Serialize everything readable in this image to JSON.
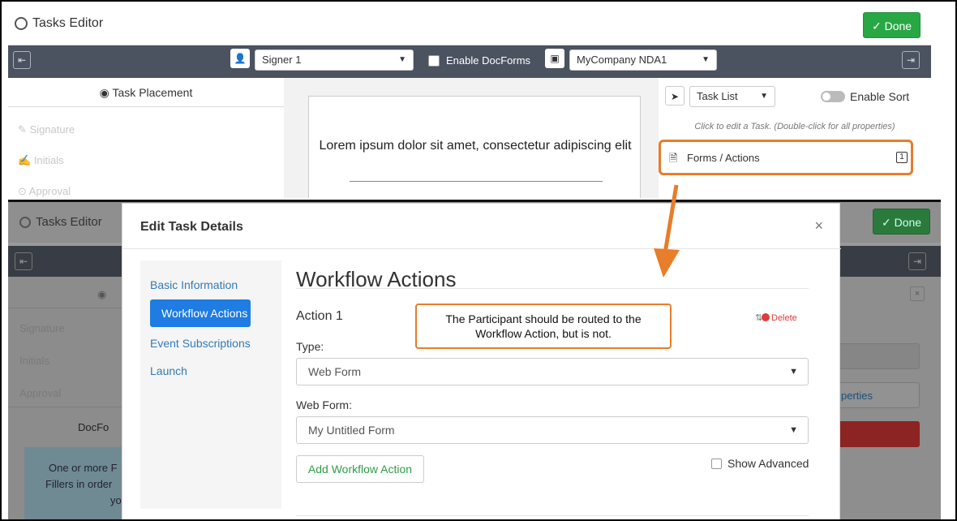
{
  "top": {
    "title": "Tasks Editor",
    "done_label": "✓ Done",
    "toolbar": {
      "signer": "Signer 1",
      "enable_docforms": "Enable DocForms",
      "document": "MyCompany NDA1"
    },
    "left_pane": {
      "header": "Task Placement",
      "items": [
        "Signature",
        "Initials",
        "Approval"
      ]
    },
    "document_text": "Lorem ipsum dolor sit amet, consectetur adipiscing elit",
    "right_pane": {
      "view_select": "Task List",
      "enable_sort": "Enable Sort",
      "hint": "Click to edit a Task. (Double-click for all properties)",
      "item_label": "Forms / Actions",
      "item_badge": "1"
    }
  },
  "bottom": {
    "title": "Tasks Editor",
    "done_label": "✓ Done",
    "left_items": [
      "Signature",
      "Initials",
      "Approval"
    ],
    "docforms_label": "DocFo",
    "info_lines": [
      "One or more F",
      "Fillers in order",
      "yo"
    ],
    "right_label": "perties"
  },
  "modal": {
    "title": "Edit Task Details",
    "close": "×",
    "nav": [
      "Basic Information",
      "Workflow Actions",
      "Event Subscriptions",
      "Launch"
    ],
    "heading": "Workflow Actions",
    "action_title": "Action 1",
    "delete_label": "Delete",
    "type_label": "Type:",
    "type_value": "Web Form",
    "web_form_label": "Web Form:",
    "web_form_value": "My Untitled Form",
    "add_button": "Add Workflow Action",
    "show_advanced": "Show Advanced"
  },
  "callout": {
    "line1": "The Participant should be routed to the",
    "line2": "Workflow Action, but is not."
  },
  "colors": {
    "accent_orange": "#e87d2a",
    "done_green": "#28a745",
    "nav_active_blue": "#1e7ce3",
    "toolbar_dark": "#4b5260",
    "delete_red": "#e03b3b"
  }
}
